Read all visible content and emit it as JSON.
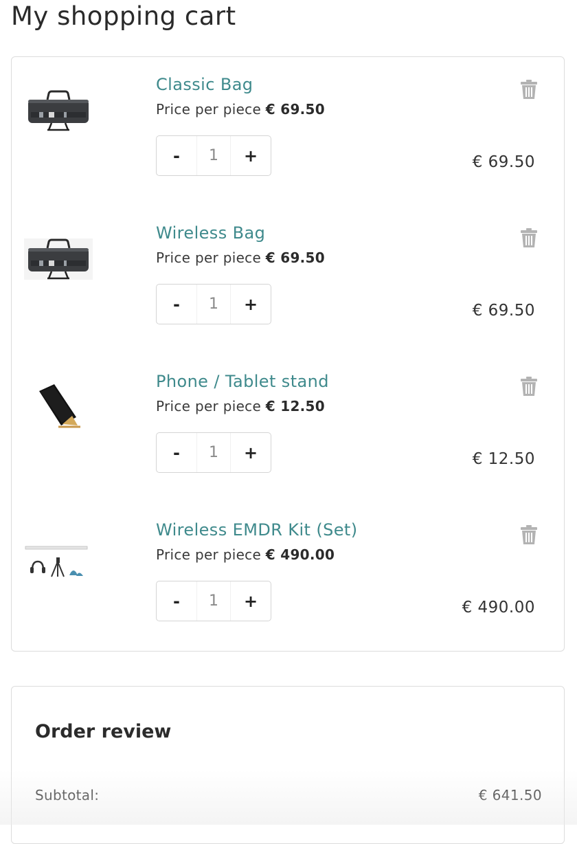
{
  "page": {
    "title": "My shopping cart"
  },
  "colors": {
    "accent": "#3f8a8c",
    "text": "#2b2b2b",
    "border": "#dcdcdc",
    "trash": "#b3b3b3"
  },
  "cart": {
    "items": [
      {
        "name": "Classic Bag",
        "price_label": "Price per piece",
        "price": "€ 69.50",
        "quantity": "1",
        "decrement": "-",
        "increment": "+",
        "line_total": "€  69.50",
        "image_icon": "bag-image"
      },
      {
        "name": "Wireless Bag",
        "price_label": "Price per piece",
        "price": "€ 69.50",
        "quantity": "1",
        "decrement": "-",
        "increment": "+",
        "line_total": "€  69.50",
        "image_icon": "bag-image"
      },
      {
        "name": "Phone / Tablet stand",
        "price_label": "Price per piece",
        "price": "€ 12.50",
        "quantity": "1",
        "decrement": "-",
        "increment": "+",
        "line_total": "€  12.50",
        "image_icon": "tablet-stand-image"
      },
      {
        "name": "Wireless EMDR Kit (Set)",
        "price_label": "Price per piece",
        "price": "€ 490.00",
        "quantity": "1",
        "decrement": "-",
        "increment": "+",
        "line_total": "€  490.00",
        "image_icon": "emdr-kit-image"
      }
    ]
  },
  "order_review": {
    "title": "Order review",
    "subtotal_label": "Subtotal:",
    "subtotal_value": "€  641.50"
  }
}
